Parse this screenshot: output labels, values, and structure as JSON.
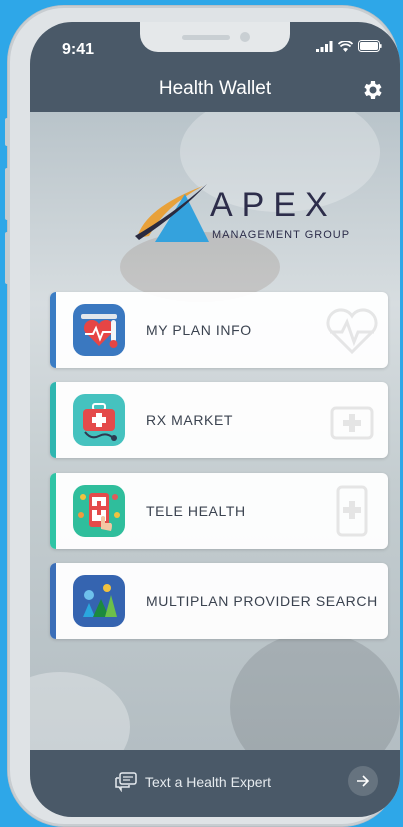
{
  "status_bar": {
    "time": "9:41"
  },
  "header": {
    "title": "Health Wallet"
  },
  "logo": {
    "brand": "APEX",
    "subtitle": "MANAGEMENT GROUP"
  },
  "menu": {
    "items": [
      {
        "label": "MY PLAN INFO",
        "icon": "heart-thermometer-icon",
        "accent": "#3b7dc4",
        "icon_bg": "#3a78c0"
      },
      {
        "label": "RX MARKET",
        "icon": "medical-kit-icon",
        "accent": "#2fb6b0",
        "icon_bg": "#45c2bf"
      },
      {
        "label": "TELE HEALTH",
        "icon": "phone-medical-icon",
        "accent": "#2fc4a5",
        "icon_bg": "#2fbe9c"
      },
      {
        "label": "MULTIPLAN PROVIDER SEARCH",
        "icon": "multiplan-logo-icon",
        "accent": "#3c6fb8",
        "icon_bg": "#3564b0"
      }
    ]
  },
  "footer": {
    "text": "Text a Health Expert"
  },
  "colors": {
    "header": "#4a5968",
    "background": "#2ea7e8"
  }
}
